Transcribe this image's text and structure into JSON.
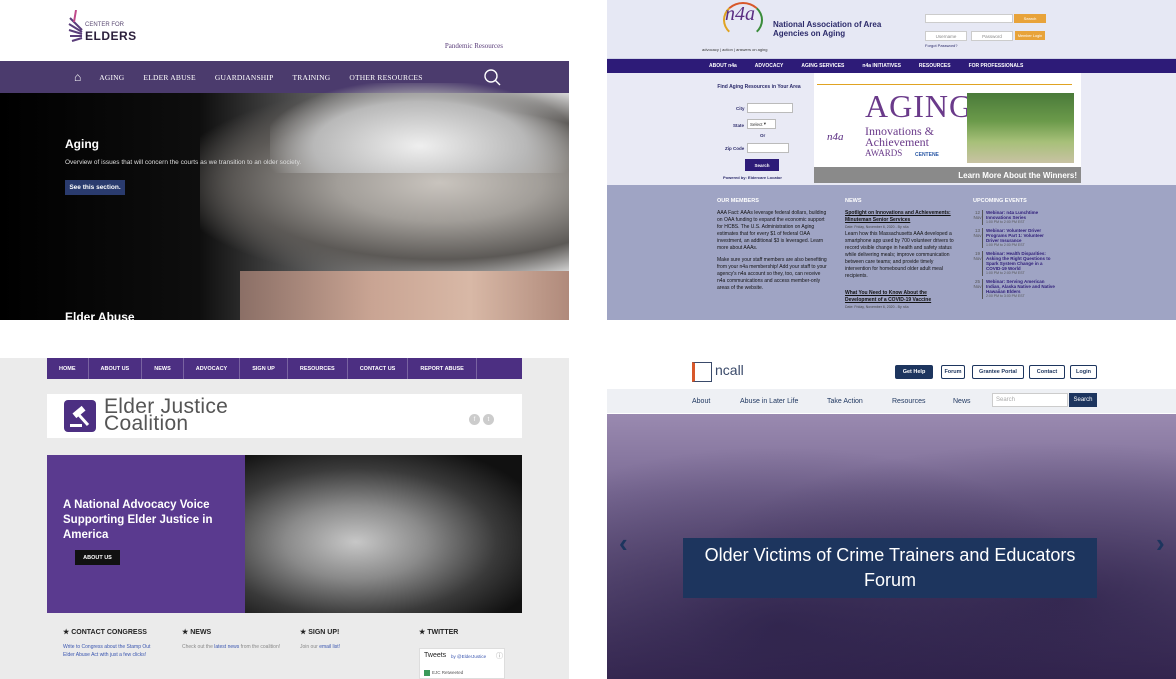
{
  "q1": {
    "logo_small": "CENTER FOR",
    "logo_big": "ELDERS",
    "pandemic": "Pandemic Resources",
    "nav": [
      "AGING",
      "ELDER ABUSE",
      "GUARDIANSHIP",
      "TRAINING",
      "OTHER RESOURCES"
    ],
    "hero_title": "Aging",
    "hero_desc": "Overview of issues that will concern the courts as we transition to an older society.",
    "hero_button": "See this section.",
    "next_title": "Elder Abuse"
  },
  "q2": {
    "logo": "n4a",
    "tagline": "advocacy | action | answers on aging",
    "org": "National Association of Area Agencies on Aging",
    "search": "Search",
    "username": "Username",
    "password": "Password",
    "member_login": "Member Login",
    "forgot": "Forgot Password?",
    "nav": [
      "ABOUT n4a",
      "ADVOCACY",
      "AGING SERVICES",
      "n4a INITIATIVES",
      "RESOURCES",
      "FOR PROFESSIONALS"
    ],
    "find": "Find Aging Resources in Your Area",
    "city": "City",
    "state": "State",
    "state_val": "Select",
    "or": "Or",
    "zip": "Zip Code",
    "go": "Search",
    "powered": "Powered by: Eldercare Locator",
    "aging": "AGING",
    "innov": "Innovations &",
    "ach": "Achievement",
    "awards": "AWARDS",
    "centene": "CENTENE",
    "winners": "Learn More About the Winners!",
    "members_h": "OUR MEMBERS",
    "members_1": "AAA Fact: AAAs leverage federal dollars, building on OAA funding to expand the economic support for HCBS. The U.S. Administration on Aging estimates that for every $1 of federal OAA investment, an additional $3 is leveraged. Learn more about AAAs.",
    "members_2": "Make sure your staff members are also benefiting from your n4a membership! Add your staff to your agency's n4a account so they, too, can receive n4a communications and access member-only areas of the website.",
    "news_h": "NEWS",
    "news_1t": "Spotlight on Innovations and Achievements: Minuteman Senior Services",
    "news_1d": "Date: Friday, November 6, 2020 - By n4a",
    "news_1b": "Learn how this Massachusetts AAA developed a smartphone app used by 700 volunteer drivers to record visible change in health and safety status while delivering meals; improve communication between care teams; and provide timely intervention for homebound older adult meal recipients.",
    "news_2t": "What You Need to Know About the Development of a COVID-19 Vaccine",
    "news_2d": "Date: Friday, November 6, 2020 - By n4a",
    "events_h": "UPCOMING EVENTS",
    "events": [
      {
        "day": "12",
        "mon": "Nov",
        "title": "Webinar: n4a Lunchtime Innovations Series",
        "time": "1:00 PM to 2:00 PM EST"
      },
      {
        "day": "13",
        "mon": "Nov",
        "title": "Webinar: Volunteer Driver Programs Part 1: Volunteer Driver Insurance",
        "time": "1:00 PM to 2:00 PM EST"
      },
      {
        "day": "19",
        "mon": "Nov",
        "title": "Webinar: Health Disparities: Asking the Right Questions to Spark System Change in a COVID-19 World",
        "time": "1:00 PM to 2:00 PM EST"
      },
      {
        "day": "25",
        "mon": "Nov",
        "title": "Webinar: Serving American Indian, Alaska Native and Native Hawaiian Elders",
        "time": "2:00 PM to 3:00 PM EST"
      }
    ]
  },
  "q3": {
    "nav": [
      "HOME",
      "ABOUT US",
      "NEWS",
      "ADVOCACY",
      "SIGN UP",
      "RESOURCES",
      "CONTACT US",
      "REPORT ABUSE"
    ],
    "title1": "Elder Justice",
    "title2": "Coalition",
    "banner": "A National Advocacy Voice Supporting Elder Justice in America",
    "about": "ABOUT US",
    "c1h": "★ CONTACT CONGRESS",
    "c1": "Write to Congress about the Stamp Out Elder Abuse Act with just a few clicks!",
    "c2h": "★ NEWS",
    "c2a": "Check out the ",
    "c2l": "latest news",
    "c2b": " from the coalition!",
    "c3h": "★ SIGN UP!",
    "c3a": "Join our ",
    "c3l": "email list!",
    "c4h": "★ TWITTER",
    "tweets": "Tweets",
    "by": "by @ElderJustice",
    "rt": "EJC Retweeted"
  },
  "q4": {
    "logo": "ncall",
    "buttons": [
      "Get Help",
      "Forum",
      "Grantee Portal",
      "Contact",
      "Login"
    ],
    "nav": [
      "About",
      "Abuse in Later Life",
      "Take Action",
      "Resources",
      "News"
    ],
    "search_ph": "Search",
    "search_btn": "Search",
    "caption": "Older Victims of Crime Trainers and Educators Forum"
  }
}
